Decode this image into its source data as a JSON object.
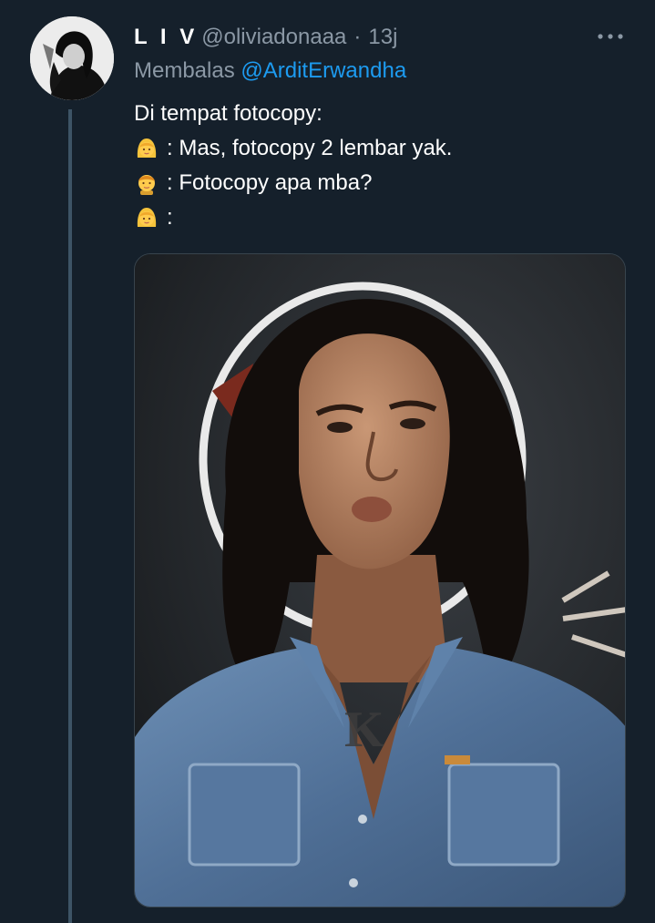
{
  "tweet": {
    "display_name": "L I V",
    "handle": "@oliviadonaaa",
    "separator": "·",
    "time": "13j",
    "reply_prefix": "Membalas",
    "reply_to": "@ArditErwandha",
    "lines": [
      "Di tempat fotocopy:",
      ": Mas, fotocopy 2 lembar yak.",
      ": Fotocopy apa mba?",
      ":"
    ],
    "line_icons": [
      "",
      "woman-emoji-icon",
      "man-emoji-icon",
      "woman-emoji-icon"
    ]
  },
  "colors": {
    "background": "#15202b",
    "muted_text": "#8b98a5",
    "link": "#1d9bf0",
    "thread_line": "#3d5466"
  },
  "icons": {
    "more": "more-horizontal-icon"
  }
}
